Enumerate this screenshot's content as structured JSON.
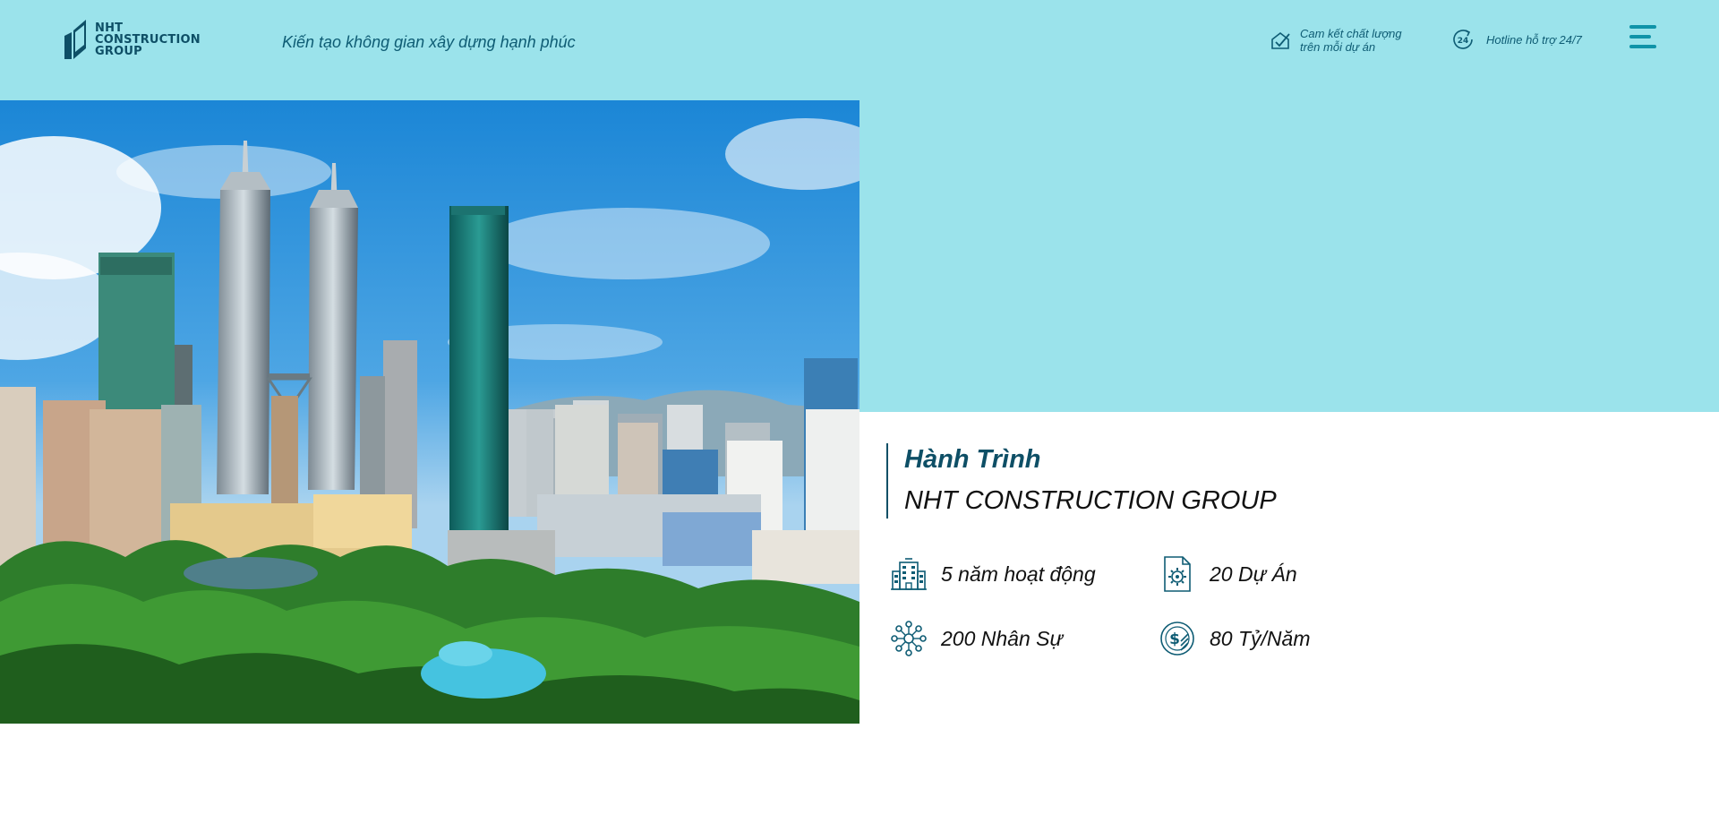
{
  "brand": {
    "logo_line1": "NHT",
    "logo_line2": "CONSTRUCTION",
    "logo_line3": "GROUP",
    "primary_color": "#0e4f66",
    "accent_color": "#0f93a8",
    "band_color": "#9be3eb"
  },
  "header": {
    "tagline": "Kiến tạo không gian xây dựng hạnh phúc",
    "commitment_line1": "Cam kết chất lượng",
    "commitment_line2": "trên mỗi dự án",
    "hotline_badge": "24",
    "hotline": "Hotline hỗ trợ 24/7",
    "menu_icon": "hamburger-icon"
  },
  "journey": {
    "title": "Hành Trình",
    "company": "NHT CONSTRUCTION GROUP"
  },
  "stats": [
    {
      "icon": "building-icon",
      "label": "5 năm hoạt động"
    },
    {
      "icon": "document-gear-icon",
      "label": "20 Dự Án"
    },
    {
      "icon": "network-people-icon",
      "label": "200 Nhân Sự"
    },
    {
      "icon": "money-coin-icon",
      "label": "80 Tỷ/Năm"
    }
  ]
}
